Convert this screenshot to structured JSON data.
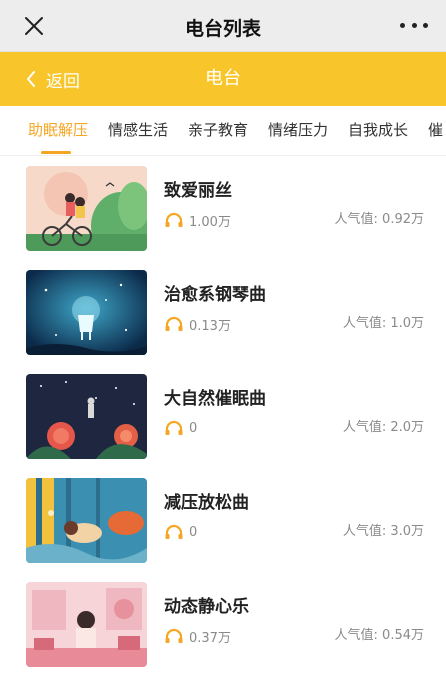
{
  "window": {
    "title": "电台列表"
  },
  "nav": {
    "back_label": "返回",
    "title": "电台"
  },
  "tabs": [
    {
      "label": "助眠解压",
      "active": true
    },
    {
      "label": "情感生活",
      "active": false
    },
    {
      "label": "亲子教育",
      "active": false
    },
    {
      "label": "情绪压力",
      "active": false
    },
    {
      "label": "自我成长",
      "active": false
    },
    {
      "label": "催",
      "active": false
    }
  ],
  "items": [
    {
      "name": "致爱丽丝",
      "plays": "1.00万",
      "popularity": "人气值: 0.92万"
    },
    {
      "name": "治愈系钢琴曲",
      "plays": "0.13万",
      "popularity": "人气值: 1.0万"
    },
    {
      "name": "大自然催眠曲",
      "plays": "0",
      "popularity": "人气值: 2.0万"
    },
    {
      "name": "减压放松曲",
      "plays": "0",
      "popularity": "人气值: 3.0万"
    },
    {
      "name": "动态静心乐",
      "plays": "0.37万",
      "popularity": "人气值: 0.54万"
    }
  ],
  "colors": {
    "accent": "#f5a623",
    "navbar": "#f8c52a",
    "titlebar": "#ededed",
    "secondary_text": "#8a8a8a"
  },
  "icons": {
    "close": "close-icon",
    "more": "more-icon",
    "back": "chevron-left-icon",
    "headphones": "headphones-icon"
  }
}
